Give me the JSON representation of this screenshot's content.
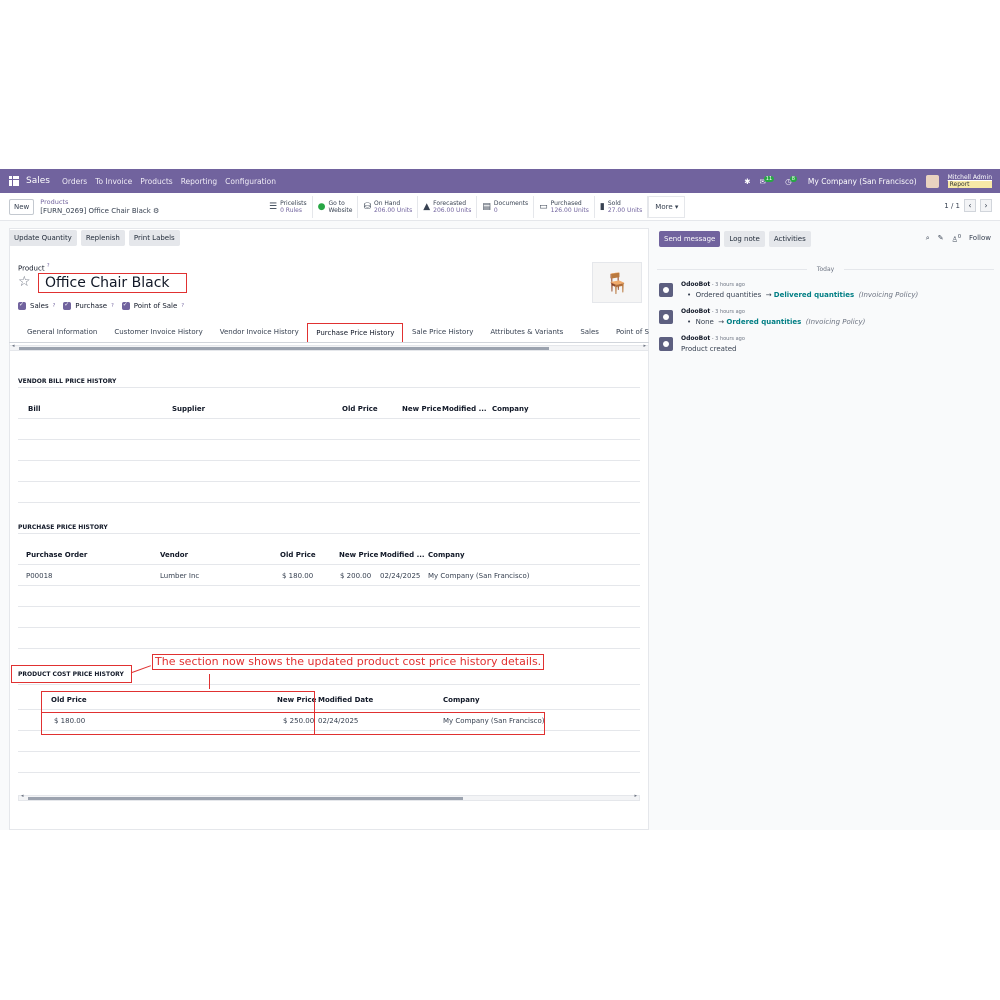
{
  "navbar": {
    "app_name": "Sales",
    "menus": [
      "Orders",
      "To Invoice",
      "Products",
      "Reporting",
      "Configuration"
    ],
    "messages_count": "11",
    "activities_count": "8",
    "company": "My Company (San Francisco)",
    "user": "Mitchell Admin",
    "report_label": "Report"
  },
  "control_panel": {
    "new_label": "New",
    "breadcrumb_parent": "Products",
    "breadcrumb_current": "[FURN_0269] Office Chair Black",
    "smart_buttons": [
      {
        "icon": "list-icon",
        "glyph": "☰",
        "title": "Pricelists",
        "value": "0 Rules"
      },
      {
        "icon": "globe-icon",
        "glyph": "●",
        "title": "Go to",
        "value": "Website"
      },
      {
        "icon": "cubes-icon",
        "glyph": "⛁",
        "title": "On Hand",
        "value": "206.00 Units"
      },
      {
        "icon": "area-chart-icon",
        "glyph": "▲",
        "title": "Forecasted",
        "value": "206.00 Units"
      },
      {
        "icon": "document-icon",
        "glyph": "▤",
        "title": "Documents",
        "value": "0"
      },
      {
        "icon": "credit-card-icon",
        "glyph": "▭",
        "title": "Purchased",
        "value": "126.00 Units"
      },
      {
        "icon": "bar-chart-icon",
        "glyph": "▮",
        "title": "Sold",
        "value": "27.00 Units"
      }
    ],
    "more_label": "More ▾",
    "pager": "1 / 1"
  },
  "status_buttons": [
    "Update Quantity",
    "Replenish",
    "Print Labels"
  ],
  "product": {
    "label": "Product",
    "name": "Office Chair Black",
    "checkboxes": [
      "Sales",
      "Purchase",
      "Point of Sale"
    ]
  },
  "tabs": [
    "General Information",
    "Customer Invoice History",
    "Vendor Invoice History",
    "Purchase Price History",
    "Sale Price History",
    "Attributes & Variants",
    "Sales",
    "Point of Sal"
  ],
  "vendor_bill": {
    "title": "VENDOR BILL PRICE HISTORY",
    "headers": [
      "Bill",
      "Supplier",
      "Old Price",
      "New Price",
      "Modified ...",
      "Company"
    ]
  },
  "purchase_price": {
    "title": "PURCHASE PRICE HISTORY",
    "headers": [
      "Purchase Order",
      "Vendor",
      "Old Price",
      "New Price",
      "Modified ...",
      "Company"
    ],
    "rows": [
      [
        "P00018",
        "Lumber Inc",
        "$ 180.00",
        "$ 200.00",
        "02/24/2025",
        "My Company (San Francisco)"
      ]
    ]
  },
  "cost_price": {
    "title": "PRODUCT COST PRICE HISTORY",
    "headers": [
      "Old Price",
      "New Price",
      "Modified Date",
      "Company"
    ],
    "rows": [
      [
        "$ 180.00",
        "$ 250.00",
        "02/24/2025",
        "My Company (San Francisco)"
      ]
    ]
  },
  "annotation": "The section now shows the updated product cost price history details.",
  "chatter": {
    "send_message": "Send message",
    "log_note": "Log note",
    "activities": "Activities",
    "follow": "Follow",
    "followers_count": "0",
    "today": "Today",
    "messages": [
      {
        "author": "OdooBot",
        "time": " - 3 hours ago",
        "old": "Ordered quantities",
        "new": "Delivered quantities",
        "field": "(Invoicing Policy)"
      },
      {
        "author": "OdooBot",
        "time": " - 3 hours ago",
        "old": "None",
        "new": "Ordered quantities",
        "field": "(Invoicing Policy)"
      },
      {
        "author": "OdooBot",
        "time": " - 3 hours ago",
        "text": "Product created"
      }
    ]
  },
  "colors": {
    "brand": "#71639e",
    "annotation": "#e03131",
    "link_teal": "#017e84"
  }
}
